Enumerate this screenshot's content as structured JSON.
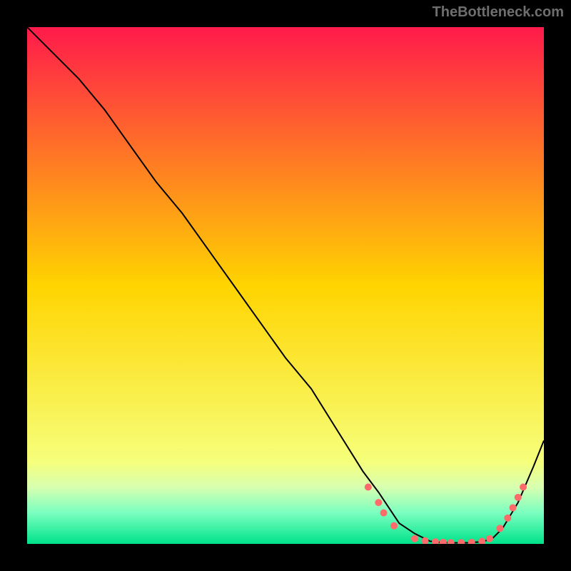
{
  "watermark": "TheBottleneck.com",
  "chart_data": {
    "type": "line",
    "title": "",
    "xlabel": "",
    "ylabel": "",
    "xlim": [
      0,
      100
    ],
    "ylim": [
      0,
      100
    ],
    "background_gradient": {
      "stops": [
        {
          "offset": 0,
          "color": "#ff1a4b"
        },
        {
          "offset": 50,
          "color": "#ffd400"
        },
        {
          "offset": 84,
          "color": "#f6ff7a"
        },
        {
          "offset": 89,
          "color": "#d8ffb0"
        },
        {
          "offset": 94,
          "color": "#7affc0"
        },
        {
          "offset": 100,
          "color": "#00e28a"
        }
      ]
    },
    "series": [
      {
        "name": "curve",
        "color": "#000000",
        "x": [
          0,
          3,
          6,
          10,
          15,
          20,
          25,
          30,
          35,
          40,
          45,
          50,
          55,
          60,
          65,
          68,
          72,
          75,
          78,
          80,
          82,
          85,
          88,
          90,
          92,
          95,
          98,
          100
        ],
        "values": [
          100,
          97,
          94,
          90,
          84,
          77,
          70,
          64,
          57,
          50,
          43,
          36,
          30,
          22,
          14,
          10,
          4,
          2,
          0.5,
          0.3,
          0.2,
          0.2,
          0.4,
          1,
          3,
          8,
          15,
          20
        ]
      }
    ],
    "markers": {
      "color": "#ff6b6b",
      "radius": 5,
      "points": [
        {
          "x": 66,
          "y": 11
        },
        {
          "x": 68,
          "y": 8
        },
        {
          "x": 69,
          "y": 6
        },
        {
          "x": 71,
          "y": 3.5
        },
        {
          "x": 75,
          "y": 1.0
        },
        {
          "x": 77,
          "y": 0.6
        },
        {
          "x": 79,
          "y": 0.4
        },
        {
          "x": 80.5,
          "y": 0.3
        },
        {
          "x": 82,
          "y": 0.25
        },
        {
          "x": 84,
          "y": 0.25
        },
        {
          "x": 86,
          "y": 0.3
        },
        {
          "x": 88,
          "y": 0.5
        },
        {
          "x": 89.5,
          "y": 1.0
        },
        {
          "x": 91.5,
          "y": 3.0
        },
        {
          "x": 93,
          "y": 5.0
        },
        {
          "x": 94,
          "y": 7.0
        },
        {
          "x": 95,
          "y": 9.0
        },
        {
          "x": 96,
          "y": 11.0
        }
      ]
    }
  }
}
